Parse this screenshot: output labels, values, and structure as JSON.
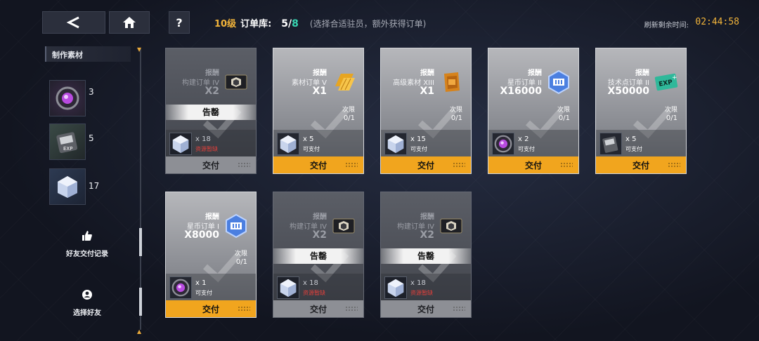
{
  "header": {
    "level": "10级",
    "library_label": "订单库:",
    "count_current": "5",
    "count_sep": "/",
    "count_max": "8",
    "hint": "(选择合适驻员，额外获得订单)",
    "refresh_label": "刷新剩余时间:",
    "timer": "02:44:58",
    "help_label": "?"
  },
  "sidebar": {
    "materials_title": "制作素材",
    "materials": [
      {
        "icon": "purple-orb-icon",
        "count": "3"
      },
      {
        "icon": "exp-chip-icon",
        "count": "5"
      },
      {
        "icon": "crystal-cube-icon",
        "count": "17"
      }
    ],
    "friend_delivery_label": "好友交付记录",
    "choose_friend_label": "选择好友"
  },
  "orders": [
    {
      "reward_label": "报酬",
      "name": "构建订单 IV",
      "qty": "X2",
      "icon": "black-ticket-icon",
      "soldout": "告罄",
      "limit_label": "",
      "limit_val": "",
      "cost_icon": "crystal-cube-icon",
      "cost_qty": "x 18",
      "cost_status": "资源暂缺",
      "deliver": "交付",
      "state": "soldout"
    },
    {
      "reward_label": "报酬",
      "name": "素材订单 V",
      "qty": "X1",
      "icon": "gold-bars-icon",
      "soldout": "",
      "limit_label": "次限",
      "limit_val": "0/1",
      "cost_icon": "crystal-cube-icon",
      "cost_qty": "x 5",
      "cost_status": "可支付",
      "deliver": "交付",
      "state": "active"
    },
    {
      "reward_label": "报酬",
      "name": "高级素材 XIII",
      "qty": "X1",
      "icon": "orange-crate-icon",
      "soldout": "",
      "limit_label": "次限",
      "limit_val": "0/1",
      "cost_icon": "crystal-cube-icon",
      "cost_qty": "x 15",
      "cost_status": "可支付",
      "deliver": "交付",
      "state": "active"
    },
    {
      "reward_label": "报酬",
      "name": "星币订单 II",
      "qty": "X16000",
      "icon": "star-coin-icon",
      "soldout": "",
      "limit_label": "次限",
      "limit_val": "0/1",
      "cost_icon": "purple-orb-icon",
      "cost_qty": "x 2",
      "cost_status": "可支付",
      "deliver": "交付",
      "state": "active"
    },
    {
      "reward_label": "报酬",
      "name": "技术点订单 II",
      "qty": "X50000",
      "icon": "exp-card-icon",
      "soldout": "",
      "limit_label": "次限",
      "limit_val": "0/1",
      "cost_icon": "exp-chip-icon",
      "cost_qty": "x 5",
      "cost_status": "可支付",
      "deliver": "交付",
      "state": "active"
    },
    {
      "reward_label": "报酬",
      "name": "星币订单 I",
      "qty": "X8000",
      "icon": "star-coin-icon",
      "soldout": "",
      "limit_label": "次限",
      "limit_val": "0/1",
      "cost_icon": "purple-orb-icon",
      "cost_qty": "x 1",
      "cost_status": "可支付",
      "deliver": "交付",
      "state": "active"
    },
    {
      "reward_label": "报酬",
      "name": "构建订单 IV",
      "qty": "X2",
      "icon": "black-ticket-icon",
      "soldout": "告罄",
      "limit_label": "",
      "limit_val": "",
      "cost_icon": "crystal-cube-icon",
      "cost_qty": "x 18",
      "cost_status": "资源暂缺",
      "deliver": "交付",
      "state": "soldout"
    },
    {
      "reward_label": "报酬",
      "name": "构建订单 IV",
      "qty": "X2",
      "icon": "black-ticket-icon",
      "soldout": "告罄",
      "limit_label": "",
      "limit_val": "",
      "cost_icon": "crystal-cube-icon",
      "cost_qty": "x 18",
      "cost_status": "资源暂缺",
      "deliver": "交付",
      "state": "soldout"
    }
  ],
  "colors": {
    "accent": "#f1a51e",
    "level": "#f2b43a",
    "count_max": "#38d6b2",
    "short": "#e2403b"
  }
}
